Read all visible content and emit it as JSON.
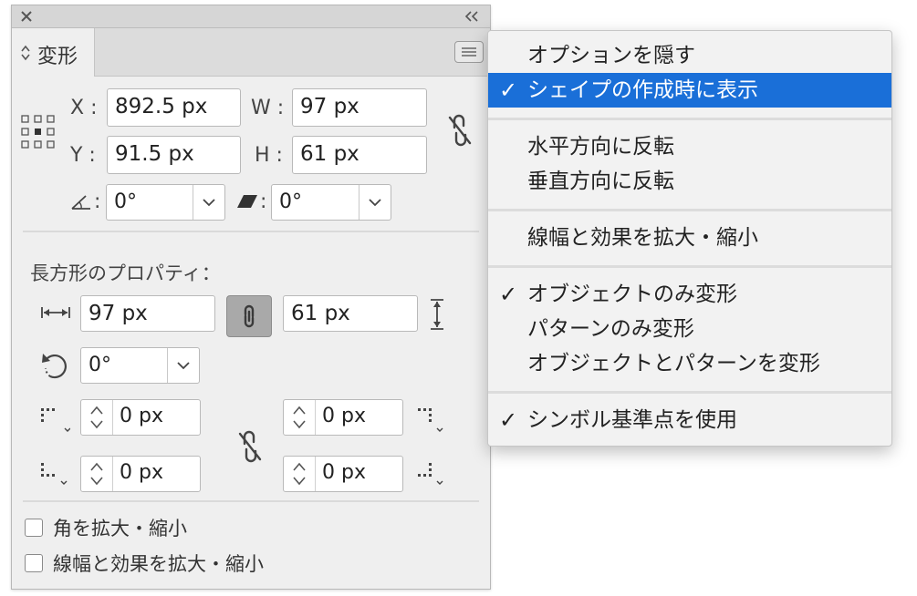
{
  "panel": {
    "tab_label": "変形",
    "x_label": "X :",
    "x_value": "892.5 px",
    "y_label": "Y :",
    "y_value": "91.5 px",
    "w_label": "W :",
    "w_value": "97 px",
    "h_label": "H :",
    "h_value": "61 px",
    "rotate_value": "0°",
    "shear_value": "0°",
    "shear_colon": ":",
    "rect_props_title": "長方形のプロパティ：",
    "rect_width": "97 px",
    "rect_height": "61 px",
    "rect_rotation": "0°",
    "corner_top_left": "0 px",
    "corner_top_right": "0 px",
    "corner_bottom_left": "0 px",
    "corner_bottom_right": "0 px",
    "scale_corners_label": "角を拡大・縮小",
    "scale_strokes_label": "線幅と効果を拡大・縮小"
  },
  "menu": {
    "items": [
      {
        "label": "オプションを隠す",
        "checked": false,
        "highlighted": false
      },
      {
        "label": "シェイプの作成時に表示",
        "checked": true,
        "highlighted": true
      },
      {
        "label": "水平方向に反転",
        "checked": false,
        "highlighted": false
      },
      {
        "label": "垂直方向に反転",
        "checked": false,
        "highlighted": false
      },
      {
        "label": "線幅と効果を拡大・縮小",
        "checked": false,
        "highlighted": false
      },
      {
        "label": "オブジェクトのみ変形",
        "checked": true,
        "highlighted": false
      },
      {
        "label": "パターンのみ変形",
        "checked": false,
        "highlighted": false
      },
      {
        "label": "オブジェクトとパターンを変形",
        "checked": false,
        "highlighted": false
      },
      {
        "label": "シンボル基準点を使用",
        "checked": true,
        "highlighted": false
      }
    ],
    "check_glyph": "✓"
  },
  "colors": {
    "highlight": "#1a6fd8",
    "panel_bg": "#efefef"
  }
}
